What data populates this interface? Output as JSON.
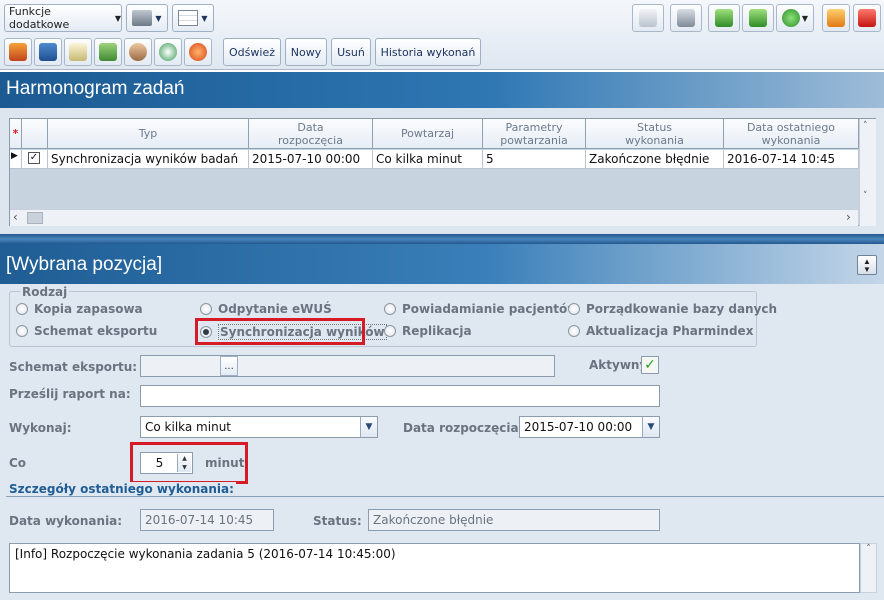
{
  "toolbar": {
    "funkcje_label": "Funkcje dodatkowe",
    "refresh_label": "Odśwież",
    "new_label": "Nowy",
    "delete_label": "Usuń",
    "history_label": "Historia wykonań"
  },
  "schedule": {
    "title": "Harmonogram zadań",
    "columns": [
      "Typ",
      "Data rozpoczęcia",
      "Powtarzaj",
      "Parametry powtarzania",
      "Status wykonania",
      "Data ostatniego wykonania"
    ],
    "row": {
      "typ": "Synchronizacja wyników badań",
      "data_rozpoczecia": "2015-07-10 00:00",
      "powtarzaj": "Co kilka minut",
      "parametry": "5",
      "status": "Zakończone błędnie",
      "data_ostatniego": "2016-07-14 10:45"
    }
  },
  "detail": {
    "title": "[Wybrana pozycja]",
    "rodzaj_label": "Rodzaj",
    "radios": {
      "kopia": "Kopia zapasowa",
      "schemat": "Schemat eksportu",
      "ewus": "Odpytanie eWUŚ",
      "sync": "Synchronizacja wyników",
      "powiad": "Powiadamianie pacjentów",
      "replik": "Replikacja",
      "porzadk": "Porządkowanie bazy danych",
      "pharm": "Aktualizacja Pharmindex"
    },
    "schemat_eksportu_label": "Schemat eksportu:",
    "schemat_button": "...",
    "aktywny_label": "Aktywny",
    "przeslij_label": "Prześlij raport na:",
    "wykonaj_label": "Wykonaj:",
    "wykonaj_value": "Co kilka minut",
    "data_rozpoczecia_label": "Data rozpoczęcia:",
    "data_rozpoczecia_value": "2015-07-10 00:00",
    "co_label": "Co",
    "co_value": "5",
    "minut_label": "minut",
    "szczegoly_label": "Szczegóły ostatniego wykonania:",
    "data_wykonania_label": "Data wykonania:",
    "data_wykonania_value": "2016-07-14 10:45",
    "status_label": "Status:",
    "status_value": "Zakończone błędnie",
    "log": "[Info] Rozpoczęcie wykonania zadania 5 (2016-07-14 10:45:00)"
  },
  "colors": {
    "header_blue": "#2e77b3",
    "highlight_red": "#d61a26"
  }
}
